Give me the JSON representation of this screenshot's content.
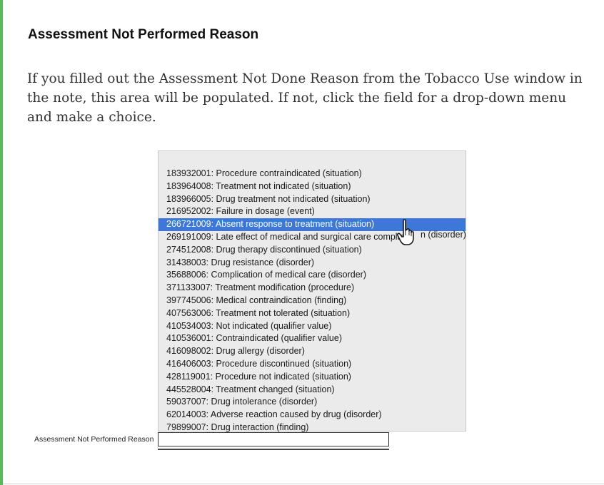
{
  "section": {
    "heading": "Assessment Not Performed Reason",
    "body": "If you filled out the Assessment Not Done Reason from the Tobacco Use window in the note, this area will be populated. If not, click the field for a drop-down menu and make a choice."
  },
  "dropdown": {
    "items": [
      "183932001: Procedure contraindicated (situation)",
      "183964008: Treatment not indicated (situation)",
      "183966005: Drug treatment not indicated (situation)",
      "216952002: Failure in dosage (event)",
      "266721009: Absent response to treatment (situation)",
      "269191009: Late effect of medical and surgical care complic",
      "274512008: Drug therapy discontinued (situation)",
      "31438003: Drug resistance (disorder)",
      "35688006: Complication of medical care (disorder)",
      "371133007: Treatment modification (procedure)",
      "397745006: Medical contraindication (finding)",
      "407563006: Treatment not tolerated (situation)",
      "410534003: Not indicated (qualifier value)",
      "410536001: Contraindicated (qualifier value)",
      "416098002: Drug allergy (disorder)",
      "416406003: Procedure discontinued (situation)",
      "428119001: Procedure not indicated (situation)",
      "445528004: Treatment changed (situation)",
      "59037007: Drug intolerance (disorder)",
      "62014003: Adverse reaction caused by drug (disorder)",
      "79899007: Drug interaction (finding)"
    ],
    "selected_index": 4,
    "overflow_text": "n (disorder)"
  },
  "field": {
    "label": "Assessment Not Performed Reason",
    "value": ""
  },
  "colors": {
    "accent_bar": "#5cb85c",
    "selection": "#3b78d8"
  },
  "icons": {
    "cursor": "hand-pointer-icon"
  }
}
